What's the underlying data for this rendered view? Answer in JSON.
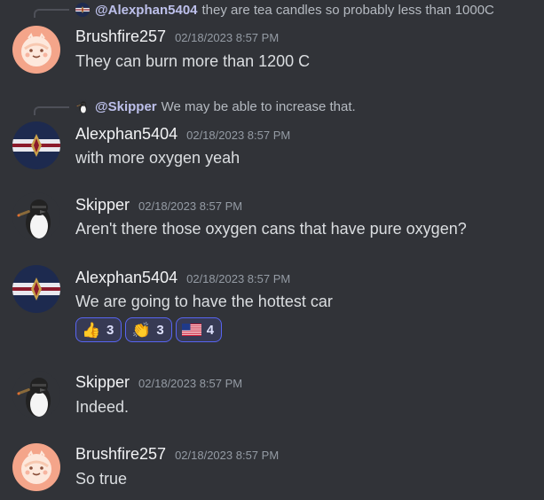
{
  "messages": [
    {
      "reply": {
        "name": "@Alexphan5404",
        "text": "they are tea candles so probably less than 1000C",
        "avatar_icon": "alexphan-avatar-icon"
      },
      "username": "Brushfire257",
      "timestamp": "02/18/2023 8:57 PM",
      "content": "They can burn more than 1200 C",
      "avatar_icon": "brushfire-avatar-icon"
    },
    {
      "reply": {
        "name": "@Skipper",
        "text": "We may be able to increase that.",
        "avatar_icon": "skipper-avatar-icon"
      },
      "username": "Alexphan5404",
      "timestamp": "02/18/2023 8:57 PM",
      "content": "with more oxygen yeah",
      "avatar_icon": "alexphan-avatar-icon"
    },
    {
      "username": "Skipper",
      "timestamp": "02/18/2023 8:57 PM",
      "content": "Aren't there those oxygen cans that have pure oxygen?",
      "avatar_icon": "skipper-avatar-icon"
    },
    {
      "username": "Alexphan5404",
      "timestamp": "02/18/2023 8:57 PM",
      "content": "We are going to have the hottest car",
      "avatar_icon": "alexphan-avatar-icon",
      "reactions": [
        {
          "emoji": "👍",
          "icon": "thumbs-up-icon",
          "count": "3"
        },
        {
          "emoji": "👏",
          "icon": "clapping-hands-icon",
          "count": "3"
        },
        {
          "emoji": "us-flag",
          "icon": "us-flag-icon",
          "count": "4"
        }
      ]
    },
    {
      "username": "Skipper",
      "timestamp": "02/18/2023 8:57 PM",
      "content": "Indeed.",
      "avatar_icon": "skipper-avatar-icon"
    },
    {
      "username": "Brushfire257",
      "timestamp": "02/18/2023 8:57 PM",
      "content": "So true",
      "avatar_icon": "brushfire-avatar-icon"
    }
  ],
  "colors": {
    "background": "#313338",
    "username": "#f2f3f5",
    "timestamp": "#949ba4",
    "text": "#dbdee1",
    "reaction_border": "#5865f2"
  }
}
